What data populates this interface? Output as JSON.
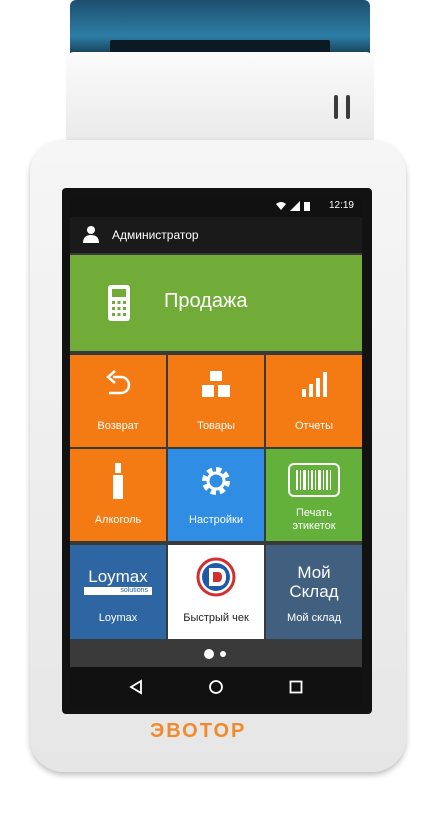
{
  "status_bar": {
    "time": "12:19"
  },
  "header": {
    "title": "Администратор"
  },
  "sale": {
    "label": "Продажа"
  },
  "tiles": [
    {
      "label": "Возврат"
    },
    {
      "label": "Товары"
    },
    {
      "label": "Отчеты"
    },
    {
      "label": "Алкоголь"
    },
    {
      "label": "Настройки"
    },
    {
      "label1": "Печать",
      "label2": "этикеток"
    },
    {
      "label": "Loymax",
      "logo": "Loymax",
      "logo_sub": "solutions"
    },
    {
      "label": "Быстрый чек"
    },
    {
      "label": "Мой склад",
      "logo1": "Мой",
      "logo2": "Склад"
    }
  ],
  "brand": {
    "logo": "ЭВОТОР"
  },
  "colors": {
    "sale": "#71ac38",
    "orange": "#f47a14",
    "blue": "#2f8de4",
    "green": "#63b03a",
    "brand": "#f08a2c"
  }
}
